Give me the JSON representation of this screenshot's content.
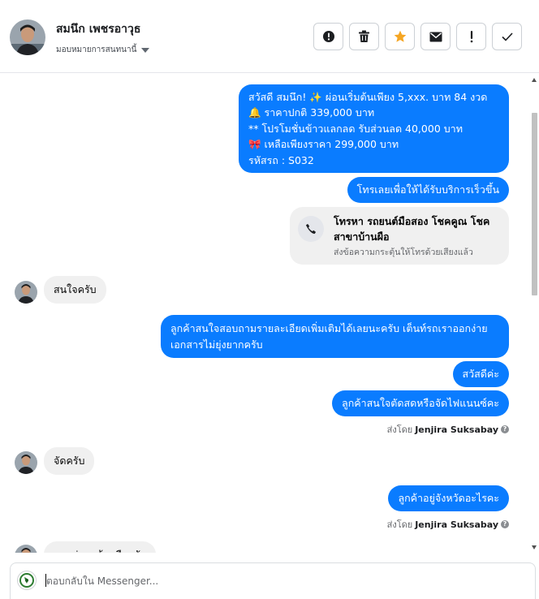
{
  "contact": {
    "name": "สมนึก เพชรอาวุธ",
    "assign_label": "มอบหมายการสนทนานี้"
  },
  "actions": [
    {
      "name": "mark-spam-button",
      "icon": "alert-circle-icon"
    },
    {
      "name": "delete-button",
      "icon": "trash-icon"
    },
    {
      "name": "star-button",
      "icon": "star-icon"
    },
    {
      "name": "mark-unread-button",
      "icon": "envelope-icon"
    },
    {
      "name": "follow-up-button",
      "icon": "exclamation-icon"
    },
    {
      "name": "mark-done-button",
      "icon": "check-icon"
    }
  ],
  "colors": {
    "outgoing_bubble": "#0a7cff",
    "incoming_bubble": "#f0f0f0",
    "star": "#f5a623"
  },
  "messages": {
    "m1": {
      "line1": "สวัสดี สมนึก! ✨  ผ่อนเริ่มต้นเพียง 5,xxx. บาท 84 งวด",
      "line2": "🔔 ราคาปกติ 339,000 บาท",
      "line3": "** โปรโมชั่นข้าวแลกลด รับส่วนลด 40,000 บาท",
      "line4": "🎀  เหลือเพียงราคา 299,000 บาท",
      "line5": " รหัสรถ : S032"
    },
    "m2": "โทรเลยเพื่อให้ได้รับบริการเร็วขึ้น",
    "call_card": {
      "title": "โทรหา รถยนต์มือสอง โชคคูณ โชค สาขาบ้านผือ",
      "subtitle": "ส่งข้อความกระตุ้นให้โทรด้วยเสียงแล้ว"
    },
    "m3": "สนใจครับ",
    "m4": "ลูกค้าสนใจสอบถามรายละเอียดเพิ่มเติมได้เลยนะครับ เต็นท์รถเราออกง่ายเอกสารไม่ยุ่งยากครับ",
    "m5": "สวัสดีค่ะ",
    "m6": "ลูกค้าสนใจตัดสดหรือจัดไฟแนนซ์คะ",
    "sent_by_prefix": "ส่งโดย",
    "sent_by_name": "Jenjira Suksabay",
    "m7": "จัดครับ",
    "m8": "ลูกค้าอยู่จังหวัดอะไรคะ",
    "m9": "ผมอยู่แถวบ้านผือครับ"
  },
  "composer": {
    "placeholder": "ตอบกลับใน Messenger..."
  }
}
